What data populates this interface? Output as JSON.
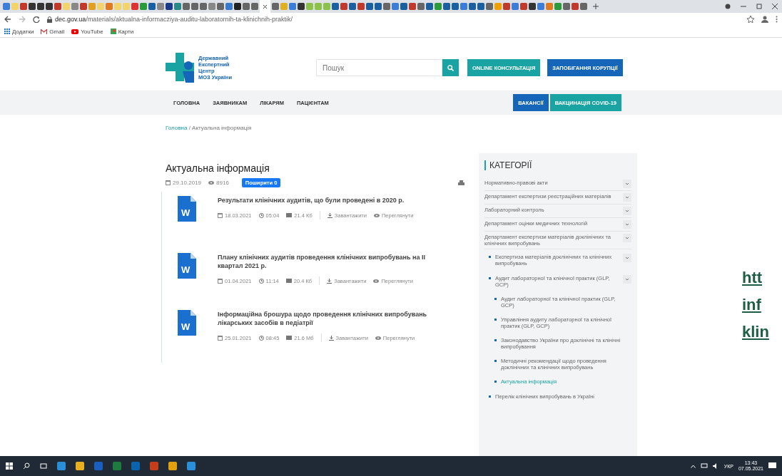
{
  "browser": {
    "url_domain": "dec.gov.ua",
    "url_path": "/materials/aktualna-informacziya-auditu-laboratornih-ta-klinichnih-praktik/",
    "bookmarks": [
      {
        "label": "Додатки"
      },
      {
        "label": "Gmail"
      },
      {
        "label": "YouTube"
      },
      {
        "label": "Карти"
      }
    ]
  },
  "header": {
    "logo_lines": [
      "Державний",
      "Експертний",
      "Центр",
      "МОЗ України"
    ],
    "search": {
      "placeholder": "Пошук"
    },
    "buttons": [
      {
        "label": "ONLINE КОНСУЛЬТАЦІЯ",
        "color": "#1aa3a3"
      },
      {
        "label": "ЗАПОБІГАННЯ КОРУПЦІЇ",
        "color": "#1565b8"
      }
    ]
  },
  "nav": {
    "items": [
      "ГОЛОВНА",
      "ЗАЯВНИКАМ",
      "ЛІКАРЯМ",
      "ПАЦІЄНТАМ"
    ],
    "buttons": [
      {
        "label": "ВАКАНСІЇ",
        "color": "#1565b8"
      },
      {
        "label": "ВАКЦИНАЦІЯ COVID-19",
        "color": "#1aa3a3"
      }
    ]
  },
  "breadcrumb": [
    {
      "label": "Головна",
      "link": true
    },
    {
      "label": "Актуальна інформація",
      "link": false
    }
  ],
  "breadcrumb_separator": "/",
  "page": {
    "title": "Актуальна інформація",
    "date": "29.10.2019",
    "views": "8916",
    "share": "Поширити 0",
    "articles": [
      {
        "title": "Результати клінічних аудитів, що були проведені в 2020 р.",
        "date": "18.03.2021",
        "time": "05:04",
        "size": "21.4 Кб",
        "icon_letter": "W",
        "download": "Завантажити",
        "view": "Переглянути"
      },
      {
        "title": "Плану клінічних аудитів проведення клінічних випробувань на II квартал 2021 р.",
        "date": "01.04.2021",
        "time": "11:14",
        "size": "20.4 Кб",
        "icon_letter": "W",
        "download": "Завантажити",
        "view": "Переглянути"
      },
      {
        "title": "Інформаційна брошура щодо проведення клінічних випробувань лікарських засобів в педіатрії",
        "date": "25.01.2021",
        "time": "08:45",
        "size": "21.6 Мб",
        "icon_letter": "W",
        "download": "Завантажити",
        "view": "Переглянути"
      }
    ]
  },
  "sidebar": {
    "title": "КАТЕГОРІЇ",
    "items": [
      {
        "label": "Нормативно-правові акти",
        "expandable": true,
        "selected": false
      },
      {
        "label": "Департамент експертизи реєстраційних матеріалів",
        "expandable": true,
        "selected": false
      },
      {
        "label": "Лабораторний контроль",
        "expandable": true,
        "selected": false
      },
      {
        "label": "Департамент оцінки медичних технологій",
        "expandable": true,
        "selected": false
      },
      {
        "label": "Департамент експертизи матеріалів доклінічних та клінічних випробувань",
        "expandable": true,
        "selected": false,
        "children": [
          {
            "label": "Експертиза матеріалів доклінічних та клінічних випробувань",
            "expandable": true,
            "selected": false
          },
          {
            "label": "Аудит лабораторної та клінічної практик (GLP, GCP)",
            "expandable": true,
            "selected": false,
            "children": [
              {
                "label": "Аудит лабораторної та клінічної практик (GLP, GCP)",
                "expandable": false,
                "selected": false
              },
              {
                "label": "Управління аудиту лабораторної та клінічної практик (GLP, GCP)",
                "expandable": false,
                "selected": false
              },
              {
                "label": "Законодавство України про доклінічні та клінічні випробування",
                "expandable": false,
                "selected": false
              },
              {
                "label": "Методичні рекомендації щодо проведення доклінічних та клінічних випробувань",
                "expandable": false,
                "selected": false
              },
              {
                "label": "Актуальна інформація",
                "expandable": false,
                "selected": true
              }
            ]
          },
          {
            "label": "Перелік клінічних випробувань в Україні",
            "expandable": false,
            "selected": false
          }
        ]
      }
    ]
  },
  "overlay_link": [
    "htt",
    "inf",
    "klin"
  ],
  "taskbar": {
    "language": "УКР",
    "time": "13:43",
    "date": "07.05.2021"
  }
}
